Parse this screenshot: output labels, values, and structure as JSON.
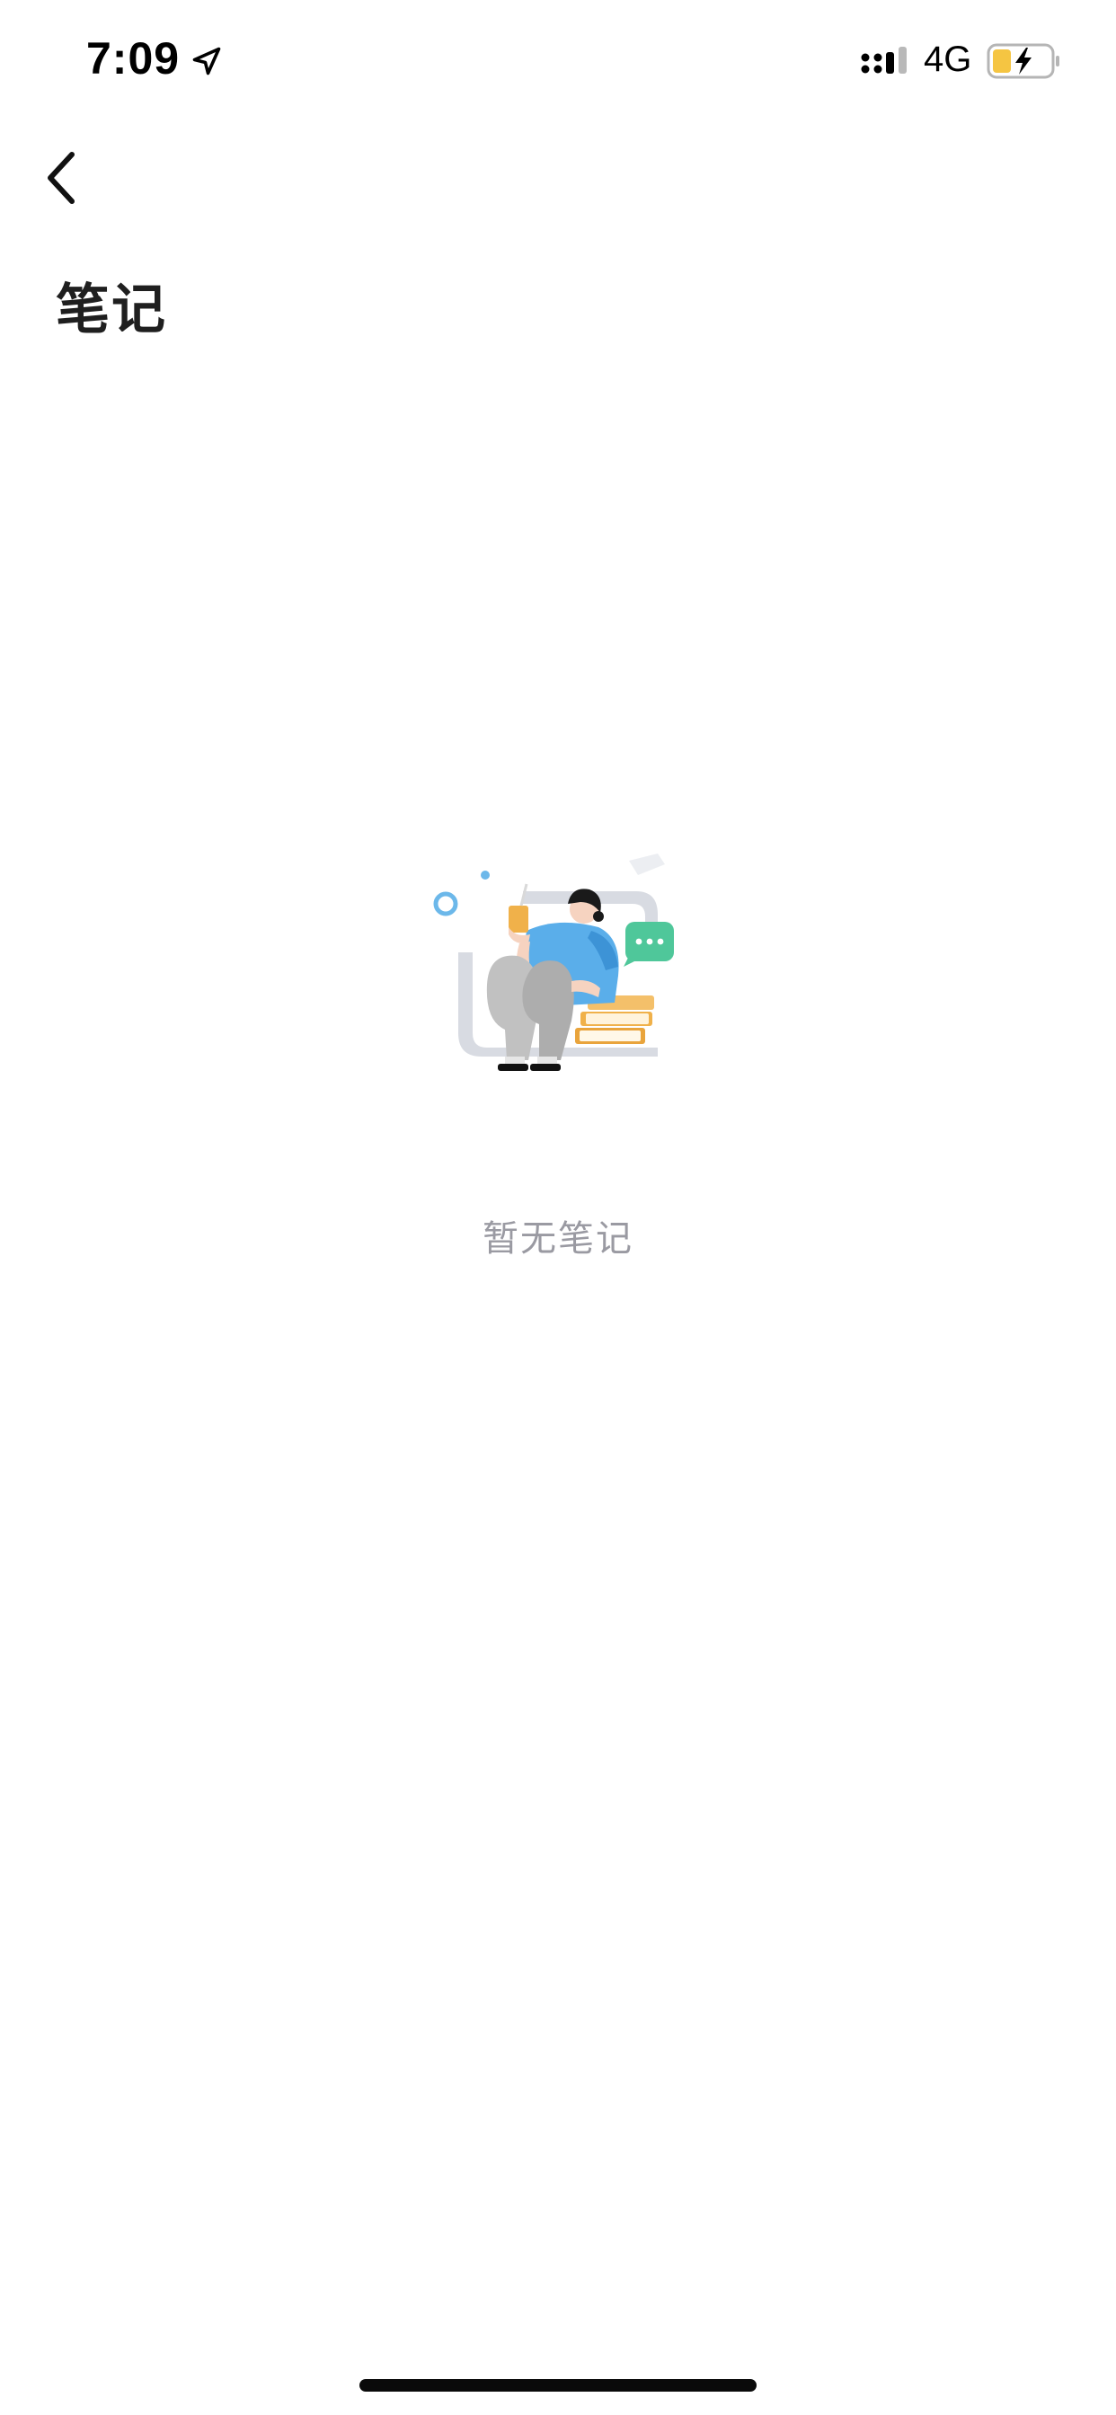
{
  "status_bar": {
    "time": "7:09",
    "network": "4G",
    "icons": [
      "location-arrow-icon",
      "cellular-signal-icon",
      "battery-charging-icon"
    ],
    "battery_color": "#f5c542"
  },
  "header": {
    "back_icon": "chevron-left-icon",
    "title": "笔记"
  },
  "empty_state": {
    "illustration": "person-reading-with-books-illustration",
    "message": "暂无笔记",
    "accent_colors": {
      "shirt": "#5aaeea",
      "chat_bubble": "#4fc79a",
      "books": "#f0b14a",
      "frame": "#d8dbe2"
    }
  }
}
